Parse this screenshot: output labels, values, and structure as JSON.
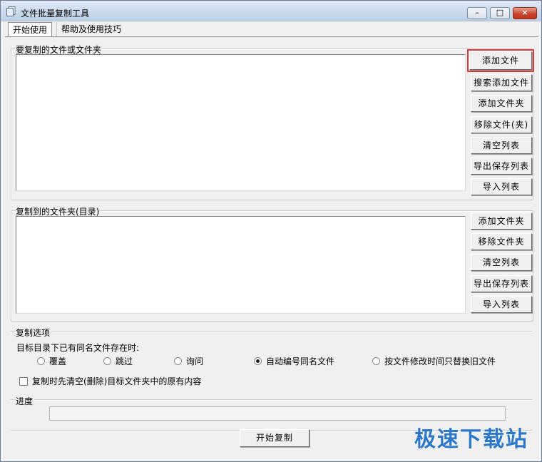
{
  "window": {
    "title": "文件批量复制工具",
    "min_label": "–",
    "max_label": "□",
    "close_label": "×"
  },
  "tabs": [
    {
      "label": "开始使用"
    },
    {
      "label": "帮助及使用技巧"
    }
  ],
  "source": {
    "group_label": "要复制的文件或文件夹",
    "buttons": {
      "add_file": "添加文件",
      "search_add_file": "搜索添加文件",
      "add_folder": "添加文件夹",
      "remove": "移除文件(夹)",
      "clear": "清空列表",
      "export": "导出保存列表",
      "import": "导入列表"
    }
  },
  "destination": {
    "group_label": "复制到的文件夹(目录)",
    "buttons": {
      "add_folder": "添加文件夹",
      "remove_folder": "移除文件夹",
      "clear": "清空列表",
      "export": "导出保存列表",
      "import": "导入列表"
    }
  },
  "options": {
    "group_label": "复制选项",
    "conflict_prompt": "目标目录下已有同名文件存在时:",
    "radios": [
      {
        "label": "覆盖",
        "checked": false
      },
      {
        "label": "跳过",
        "checked": false
      },
      {
        "label": "询问",
        "checked": false
      },
      {
        "label": "自动编号同名文件",
        "checked": true
      },
      {
        "label": "按文件修改时间只替换旧文件",
        "checked": false
      }
    ],
    "clear_target_label": "复制时先清空(删除)目标文件夹中的原有内容",
    "clear_target_checked": false
  },
  "progress": {
    "label": "进度",
    "value": 0
  },
  "start_button": "开始复制",
  "watermark": "极速下载站",
  "colors": {
    "highlight": "#d93a3a",
    "watermark": "#2b77c9"
  }
}
